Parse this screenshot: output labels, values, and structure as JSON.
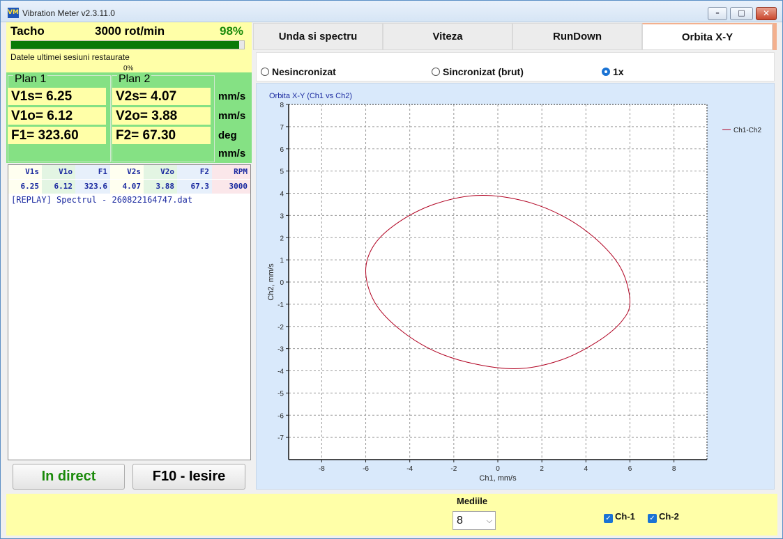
{
  "window": {
    "title": "Vibration Meter v2.3.11.0",
    "icon": "VM"
  },
  "tacho": {
    "label": "Tacho",
    "rpm": "3000 rot/min",
    "percent": "98%",
    "progress": 0.98,
    "status": "Datele ultimei sesiuni restaurate",
    "progress_text": "0%"
  },
  "plan1": {
    "title": "Plan 1",
    "v1s": "V1s= 6.25",
    "v1o": "V1o= 6.12",
    "f1": "F1= 323.60"
  },
  "plan2": {
    "title": "Plan 2",
    "v2s": "V2s= 4.07",
    "v2o": "V2o= 3.88",
    "f2": "F2= 67.30"
  },
  "units": [
    "mm/s",
    "mm/s",
    "deg",
    "mm/s"
  ],
  "table": {
    "headers": [
      "V1s",
      "V1o",
      "F1",
      "V2s",
      "V2o",
      "F2",
      "RPM"
    ],
    "row": [
      "6.25",
      "6.12",
      "323.6",
      "4.07",
      "3.88",
      "67.3",
      "3000"
    ],
    "log": "[REPLAY] Spectrul - 260822164747.dat"
  },
  "buttons": {
    "live": "In direct",
    "exit": "F10 - Iesire"
  },
  "tabs": [
    "Unda si spectru",
    "Viteza",
    "RunDown",
    "Orbita X-Y"
  ],
  "active_tab": "Orbita X-Y",
  "radios": {
    "unsync": "Nesincronizat",
    "sync": "Sincronizat (brut)",
    "onex": "1x",
    "selected": "1x"
  },
  "bottom": {
    "mediile_label": "Mediile",
    "mediile_value": "8",
    "ch1": "Ch-1",
    "ch2": "Ch-2"
  },
  "colors": {
    "orbit": "#b00020",
    "accent": "#1a73d4",
    "panel_yellow": "#ffffa8",
    "panel_green": "#85e184"
  },
  "chart_data": {
    "type": "line",
    "title": "Orbita X-Y (Ch1 vs Ch2)",
    "xlabel": "Ch1, mm/s",
    "ylabel": "Ch2, mm/s",
    "xlim": [
      -9.5,
      9.5
    ],
    "ylim": [
      -8,
      8
    ],
    "xticks": [
      -8,
      -6,
      -4,
      -2,
      0,
      2,
      4,
      6,
      8
    ],
    "yticks": [
      8,
      7,
      6,
      5,
      4,
      3,
      2,
      1,
      0,
      -1,
      -2,
      -3,
      -4,
      -5,
      -6,
      -7
    ],
    "grid": true,
    "legend_position": "top-right",
    "series": [
      {
        "name": "Ch1-Ch2",
        "color": "#b00020",
        "x": [
          6.0,
          5.6,
          4.5,
          2.9,
          1.0,
          -1.0,
          -2.9,
          -4.5,
          -5.6,
          -6.0,
          -5.6,
          -4.5,
          -2.9,
          -1.0,
          1.0,
          2.9,
          4.5,
          5.6,
          6.0
        ],
        "y": [
          -0.9,
          0.6,
          1.9,
          3.0,
          3.7,
          3.9,
          3.5,
          2.7,
          1.7,
          0.5,
          -0.9,
          -2.1,
          -3.1,
          -3.7,
          -3.9,
          -3.5,
          -2.7,
          -1.8,
          -0.9
        ]
      }
    ]
  }
}
